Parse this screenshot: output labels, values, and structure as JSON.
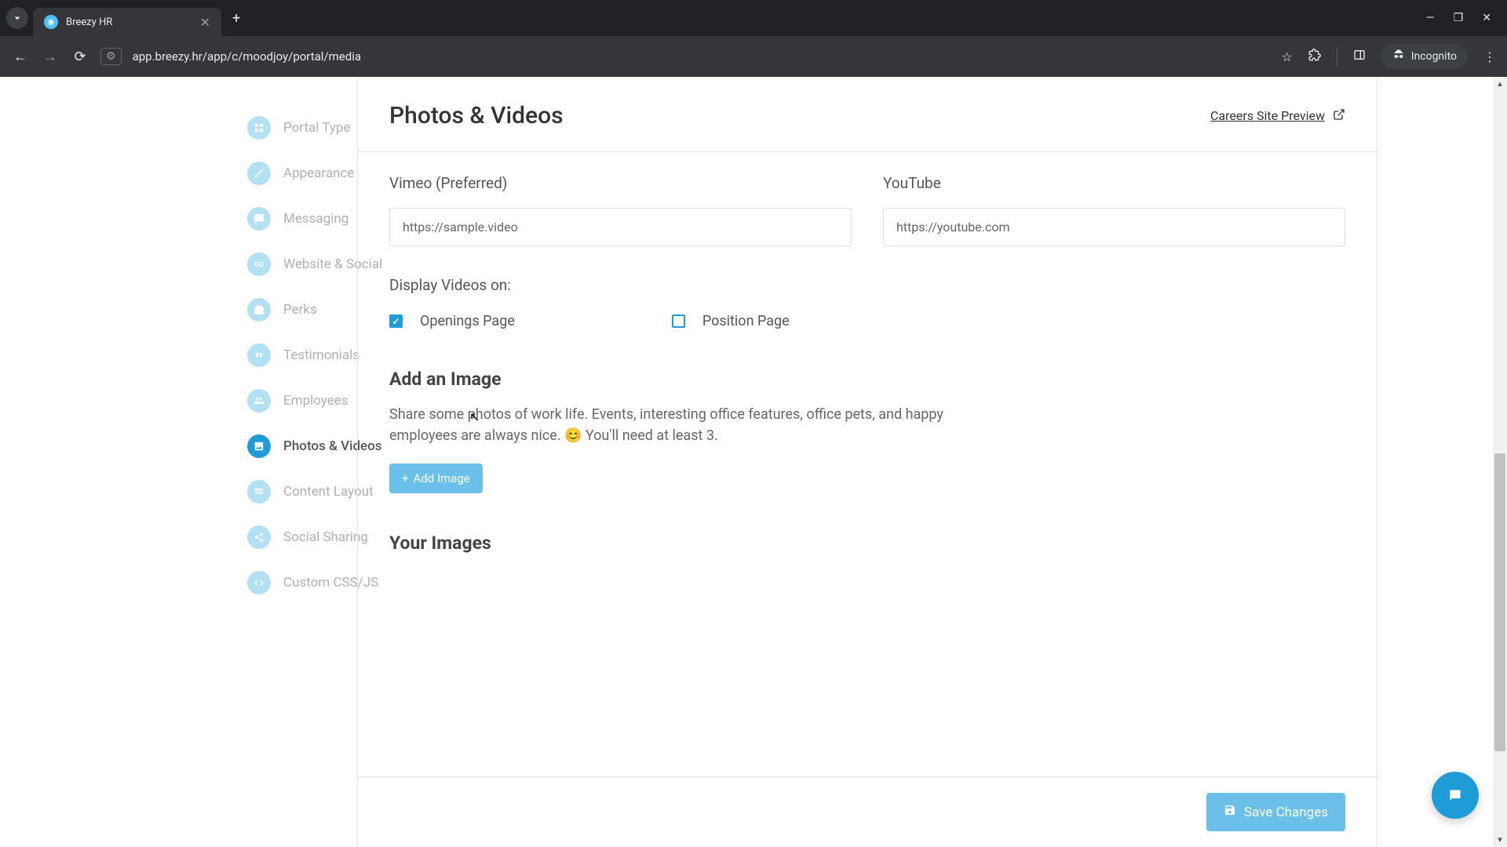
{
  "browser": {
    "tab_title": "Breezy HR",
    "url": "app.breezy.hr/app/c/moodjoy/portal/media",
    "incognito_label": "Incognito"
  },
  "sidebar": {
    "items": [
      {
        "label": "Portal Type"
      },
      {
        "label": "Appearance"
      },
      {
        "label": "Messaging"
      },
      {
        "label": "Website & Social"
      },
      {
        "label": "Perks"
      },
      {
        "label": "Testimonials"
      },
      {
        "label": "Employees"
      },
      {
        "label": "Photos & Videos"
      },
      {
        "label": "Content Layout"
      },
      {
        "label": "Social Sharing"
      },
      {
        "label": "Custom CSS/JS"
      }
    ]
  },
  "header": {
    "title": "Photos & Videos",
    "preview_label": "Careers Site Preview"
  },
  "videos": {
    "vimeo_label": "Vimeo (Preferred)",
    "vimeo_value": "https://sample.video",
    "youtube_label": "YouTube",
    "youtube_value": "https://youtube.com",
    "display_label": "Display Videos on:",
    "cb_openings": "Openings Page",
    "cb_position": "Position Page"
  },
  "add_image": {
    "title": "Add an Image",
    "help": "Share some photos of work life. Events, interesting office features, office pets, and happy employees are always nice. 😊 You'll need at least 3.",
    "button": "Add Image"
  },
  "your_images": {
    "title": "Your Images"
  },
  "footer": {
    "save": "Save Changes"
  }
}
